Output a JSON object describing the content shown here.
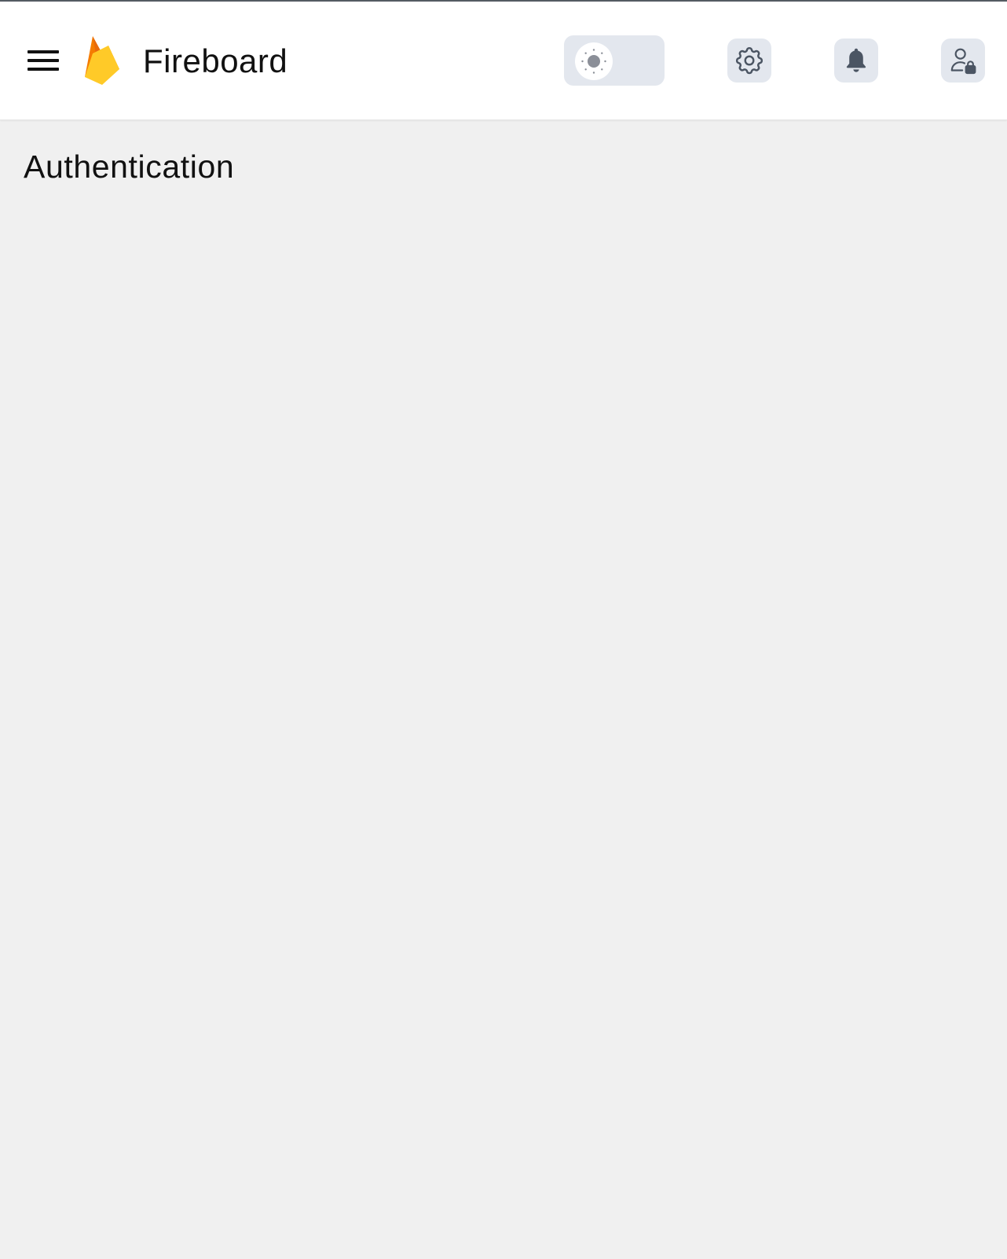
{
  "app": {
    "title": "Fireboard"
  },
  "header": {
    "menu_icon": "hamburger-menu-icon",
    "logo_icon": "firebase-flame-logo",
    "theme_toggle": {
      "icon": "sun-icon",
      "state": "light"
    },
    "actions": [
      {
        "name": "settings",
        "icon": "gear-icon"
      },
      {
        "name": "notifications",
        "icon": "bell-icon"
      },
      {
        "name": "account",
        "icon": "user-lock-icon"
      }
    ]
  },
  "page": {
    "title": "Authentication"
  },
  "colors": {
    "background": "#f0f0f0",
    "header_background": "#ffffff",
    "button_background": "#e3e7ee",
    "icon_color": "#4b5563",
    "flame_orange": "#f57c00",
    "flame_yellow": "#ffca28",
    "flame_amber": "#ffa000"
  }
}
